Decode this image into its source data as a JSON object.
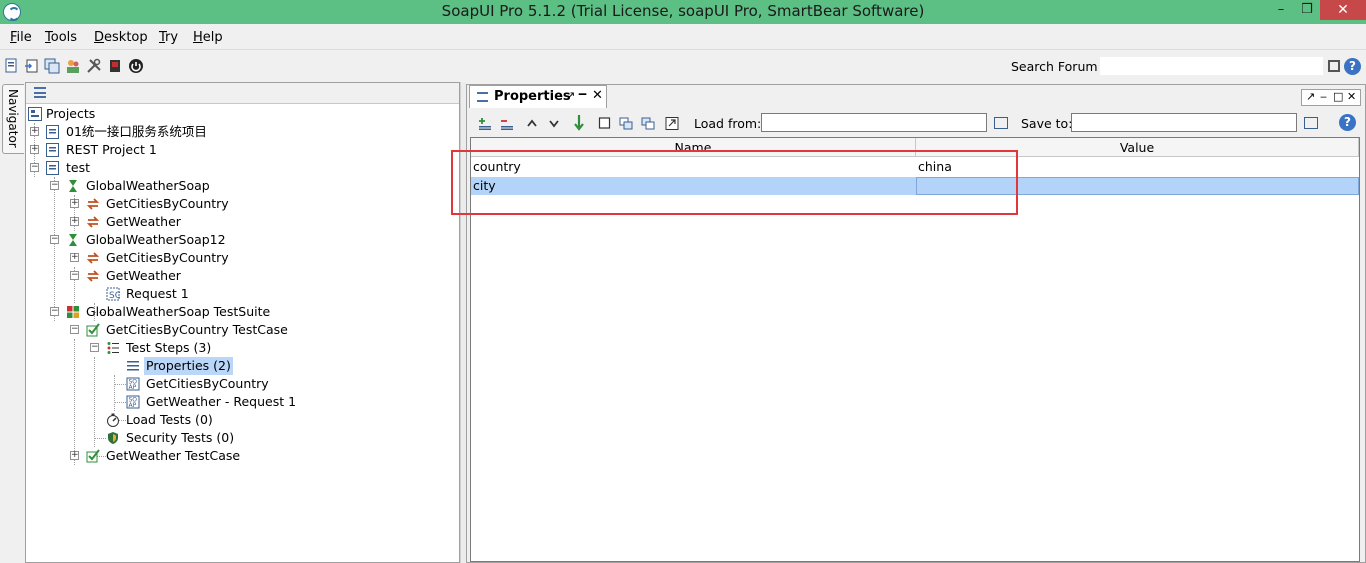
{
  "window": {
    "title": "SoapUI Pro 5.1.2 (Trial License, soapUI Pro, SmartBear Software)"
  },
  "window_controls": {
    "minimize": "–",
    "restore": "❒",
    "close": "✕"
  },
  "menu": [
    "File",
    "Tools",
    "Desktop",
    "Try",
    "Help"
  ],
  "toolbar": {
    "icons": [
      "new-project-icon",
      "import-project-icon",
      "save-all-icon",
      "forum-icon",
      "preferences-icon",
      "stop-icon",
      "exit-icon"
    ],
    "search_label": "Search Forum",
    "search_value": "",
    "help": "?"
  },
  "navigator": {
    "tab_label": "Navigator",
    "tree": [
      {
        "label": "Projects",
        "icon": "projects-icon"
      },
      {
        "label": "01统一接口服务系统项目",
        "icon": "project-icon"
      },
      {
        "label": "REST Project 1",
        "icon": "project-icon"
      },
      {
        "label": "test",
        "icon": "project-icon"
      },
      {
        "label": "GlobalWeatherSoap",
        "icon": "interface-icon"
      },
      {
        "label": "GetCitiesByCountry",
        "icon": "operation-icon"
      },
      {
        "label": "GetWeather",
        "icon": "operation-icon"
      },
      {
        "label": "GlobalWeatherSoap12",
        "icon": "interface-icon"
      },
      {
        "label": "GetCitiesByCountry",
        "icon": "operation-icon"
      },
      {
        "label": "GetWeather",
        "icon": "operation-icon"
      },
      {
        "label": "Request 1",
        "icon": "request-icon"
      },
      {
        "label": "GlobalWeatherSoap TestSuite",
        "icon": "testsuite-icon"
      },
      {
        "label": "GetCitiesByCountry TestCase",
        "icon": "testcase-icon"
      },
      {
        "label": "Test Steps (3)",
        "icon": "teststeps-icon"
      },
      {
        "label": "Properties (2)",
        "icon": "properties-icon",
        "selected": true
      },
      {
        "label": "GetCitiesByCountry",
        "icon": "soap-step-icon"
      },
      {
        "label": "GetWeather - Request 1",
        "icon": "soap-step-icon"
      },
      {
        "label": "Load Tests (0)",
        "icon": "loadtests-icon"
      },
      {
        "label": "Security Tests (0)",
        "icon": "securitytests-icon"
      },
      {
        "label": "GetWeather TestCase",
        "icon": "testcase-icon"
      }
    ]
  },
  "properties": {
    "tab_title": "Properties",
    "tab_pin": "↗",
    "tab_minimize": "‒",
    "tab_close": "✕",
    "win_controls": [
      "↗",
      "‒",
      "□",
      "✕"
    ],
    "load_from_label": "Load from:",
    "load_from_value": "",
    "save_to_label": "Save to:",
    "save_to_value": "",
    "help": "?",
    "columns": [
      "Name",
      "Value"
    ],
    "rows": [
      {
        "name": "country",
        "value": "china"
      },
      {
        "name": "city",
        "value": ""
      }
    ],
    "selected_row": 1
  },
  "colors": {
    "titlebar": "#5cbf84",
    "close_button": "#c74848",
    "selection": "#b3d4f8",
    "annotation_box": "#e0363c"
  }
}
